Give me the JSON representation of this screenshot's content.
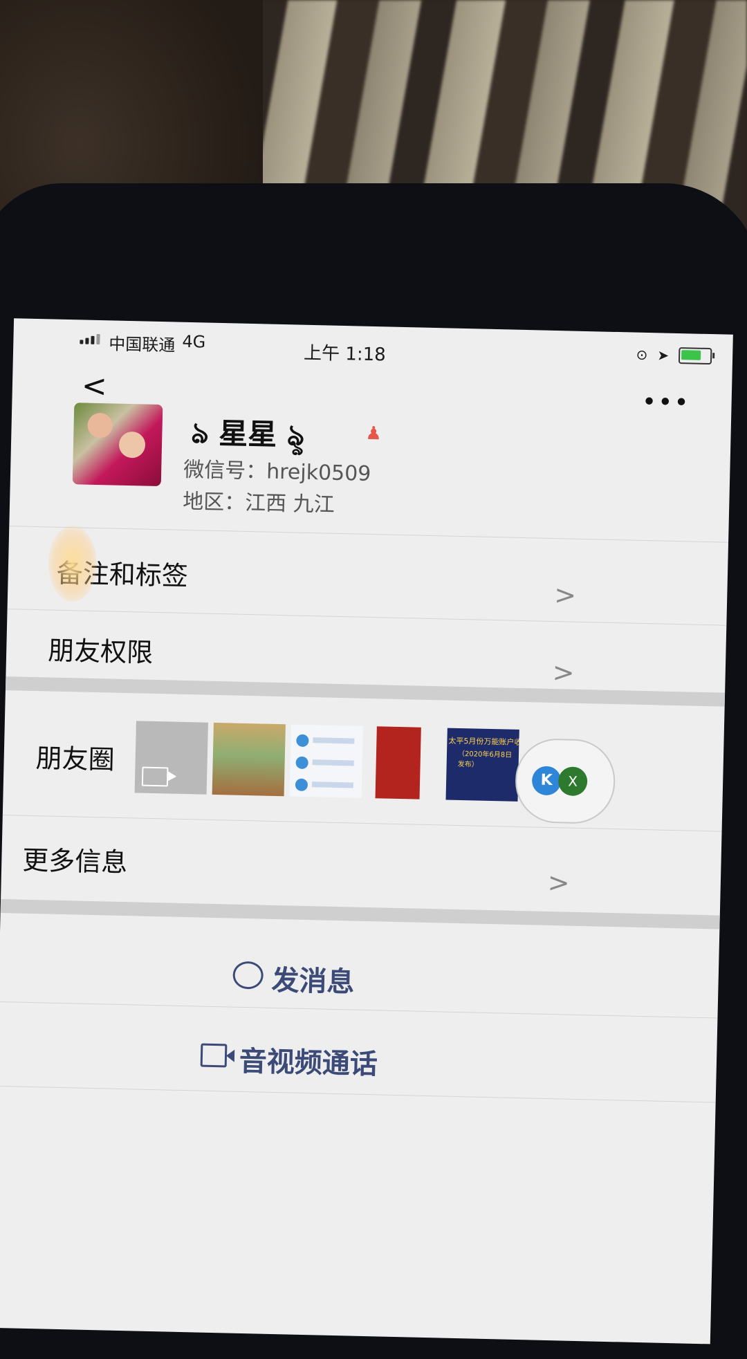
{
  "status_bar": {
    "carrier": "中国联通",
    "network": "4G",
    "time": "上午 1:18"
  },
  "profile": {
    "nickname": "ঌ 星星 ৡ",
    "wechat_id": "微信号：hrejk0509",
    "region": "地区：江西 九江"
  },
  "rows": {
    "remark_tags": "备注和标签",
    "friend_permissions": "朋友权限",
    "moments": "朋友圈",
    "more_info": "更多信息"
  },
  "moments_thumb_text": {
    "title": "太平5月份万能账户收益",
    "subtitle": "（2020年6月8日发布）"
  },
  "float_widget": {
    "left_label": "K",
    "right_label": "X"
  },
  "actions": {
    "send_message": "发消息",
    "av_call": "音视频通话"
  },
  "icons": {
    "chevron": ">",
    "back": "<",
    "more": "•••"
  }
}
